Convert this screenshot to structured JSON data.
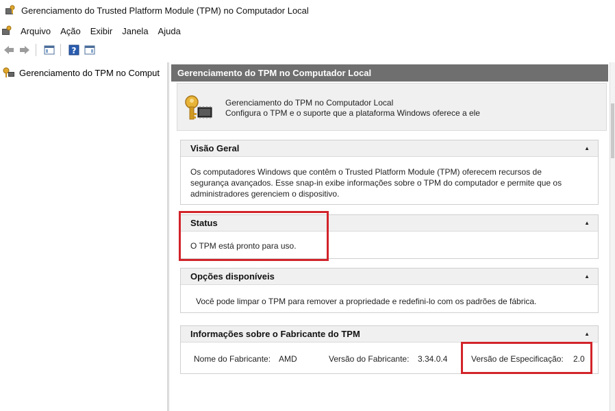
{
  "window": {
    "title": "Gerenciamento do Trusted Platform Module (TPM) no Computador Local"
  },
  "menu": {
    "items": [
      "Arquivo",
      "Ação",
      "Exibir",
      "Janela",
      "Ajuda"
    ]
  },
  "toolbar": {
    "buttons": [
      "back-arrow-icon",
      "forward-arrow-icon",
      "show-hide-tree-icon",
      "help-icon",
      "show-hide-action-pane-icon"
    ]
  },
  "tree": {
    "root_label": "Gerenciamento do TPM no Comput"
  },
  "main": {
    "header": "Gerenciamento do TPM no Computador Local",
    "intro": {
      "line1": "Gerenciamento do TPM no Computador Local",
      "line2": "Configura o TPM e o suporte que a plataforma Windows oferece a ele"
    },
    "overview": {
      "title": "Visão Geral",
      "text_line1": "Os computadores Windows que contêm o Trusted Platform Module (TPM) oferecem recursos de",
      "text_line2": "segurança avançados. Esse snap-in exibe informações sobre o TPM do computador e permite que os",
      "text_line3": "administradores gerenciem o dispositivo."
    },
    "status": {
      "title": "Status",
      "text": "O TPM está pronto para uso."
    },
    "options": {
      "title": "Opções disponíveis",
      "text": "Você pode limpar o TPM para remover a propriedade e redefini-lo com os padrões de fábrica."
    },
    "manufacturer": {
      "title": "Informações sobre o Fabricante do TPM",
      "name_label": "Nome do Fabricante:",
      "name_value": "AMD",
      "version_label": "Versão do Fabricante:",
      "version_value": "3.34.0.4",
      "spec_label": "Versão de Especificação:",
      "spec_value": "2.0"
    },
    "collapse_glyph": "▲"
  },
  "colors": {
    "header_bg": "#6f6f6f",
    "highlight_border": "#d2232a",
    "panel_header_bg": "#f0f0f0"
  }
}
